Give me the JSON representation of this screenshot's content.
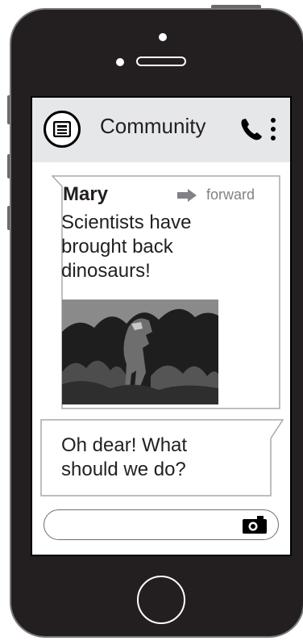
{
  "header": {
    "title": "Community",
    "app_icon": "newspaper-icon",
    "call_icon": "phone-icon",
    "menu_icon": "more-vertical-icon"
  },
  "messages": [
    {
      "sender": "Mary",
      "forward_label": "forward",
      "text": "Scientists have brought back dinosaurs!",
      "has_photo": true
    },
    {
      "text": "Oh dear! What should we do?"
    }
  ],
  "composer": {
    "value": "",
    "placeholder": "",
    "camera_icon": "camera-icon"
  },
  "colors": {
    "phone_body": "#231f20",
    "header_bg": "#e6e7e8",
    "bubble_border": "#a7a9ac",
    "forward_gray": "#808285"
  }
}
